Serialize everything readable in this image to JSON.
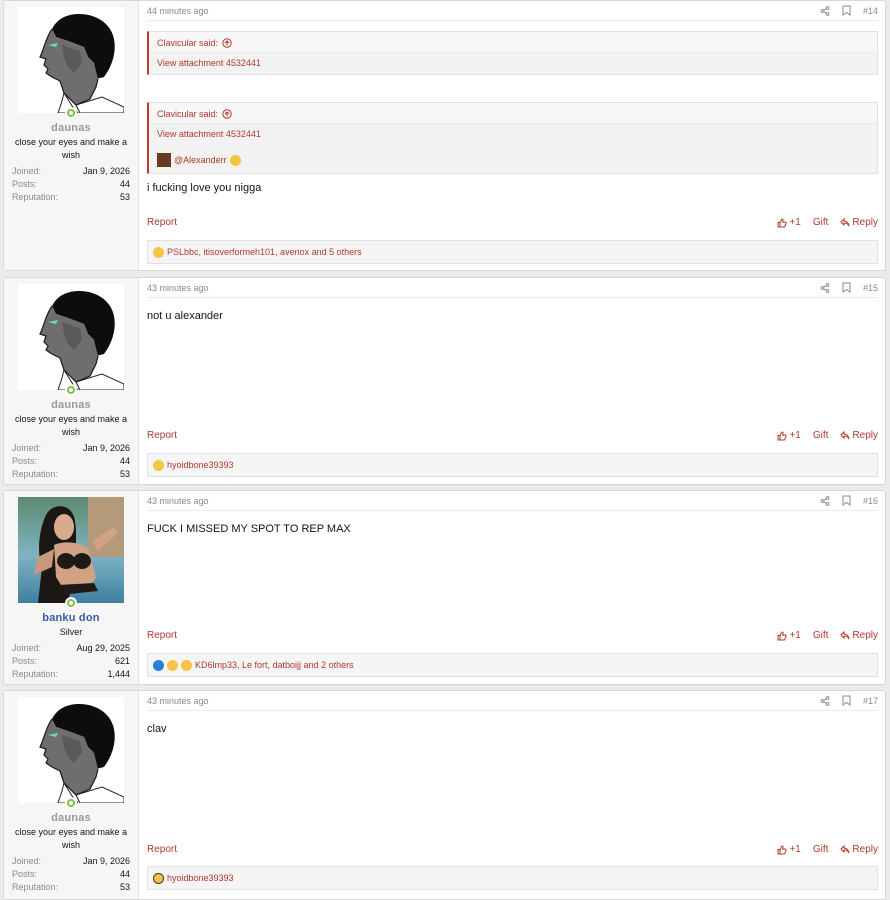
{
  "posts": [
    {
      "time": "44 minutes ago",
      "number": "#14",
      "user": {
        "name": "daunas",
        "title": "close your eyes and make a wish",
        "joined_label": "Joined:",
        "joined": "Jan 9, 2026",
        "posts_label": "Posts:",
        "posts": "44",
        "rep_label": "Reputation:",
        "rep": "53"
      },
      "quotes": [
        {
          "author": "Clavicular said:",
          "link": "View attachment 4532441"
        },
        {
          "author": "Clavicular said:",
          "link": "View attachment 4532441",
          "mention": "@Alexanderr"
        }
      ],
      "text": "i fucking love you nigga",
      "reactions": "PSLbbc, itisoverformeh101, avenox and 5 others"
    },
    {
      "time": "43 minutes ago",
      "number": "#15",
      "user": {
        "name": "daunas",
        "title": "close your eyes and make a wish",
        "joined_label": "Joined:",
        "joined": "Jan 9, 2026",
        "posts_label": "Posts:",
        "posts": "44",
        "rep_label": "Reputation:",
        "rep": "53"
      },
      "text": "not u alexander",
      "reactions": "hyoidbone39393"
    },
    {
      "time": "43 minutes ago",
      "number": "#16",
      "user": {
        "name": "banku don",
        "title": "Silver",
        "joined_label": "Joined:",
        "joined": "Aug 29, 2025",
        "posts_label": "Posts:",
        "posts": "621",
        "rep_label": "Reputation:",
        "rep": "1,444"
      },
      "text": "FUCK I MISSED MY SPOT TO REP MAX",
      "reactions": "KD6lmp33, Le fort, datboijj and 2 others"
    },
    {
      "time": "43 minutes ago",
      "number": "#17",
      "user": {
        "name": "daunas",
        "title": "close your eyes and make a wish",
        "joined_label": "Joined:",
        "joined": "Jan 9, 2026",
        "posts_label": "Posts:",
        "posts": "44",
        "rep_label": "Reputation:",
        "rep": "53"
      },
      "text": "clav",
      "reactions": "hyoidbone39393"
    }
  ],
  "actions": {
    "report": "Report",
    "plus_one": "+1",
    "gift": "Gift",
    "reply": "Reply"
  },
  "colors": {
    "accent": "#b0392b",
    "online": "#7ec24a",
    "username_blue": "#3a5aa5"
  }
}
